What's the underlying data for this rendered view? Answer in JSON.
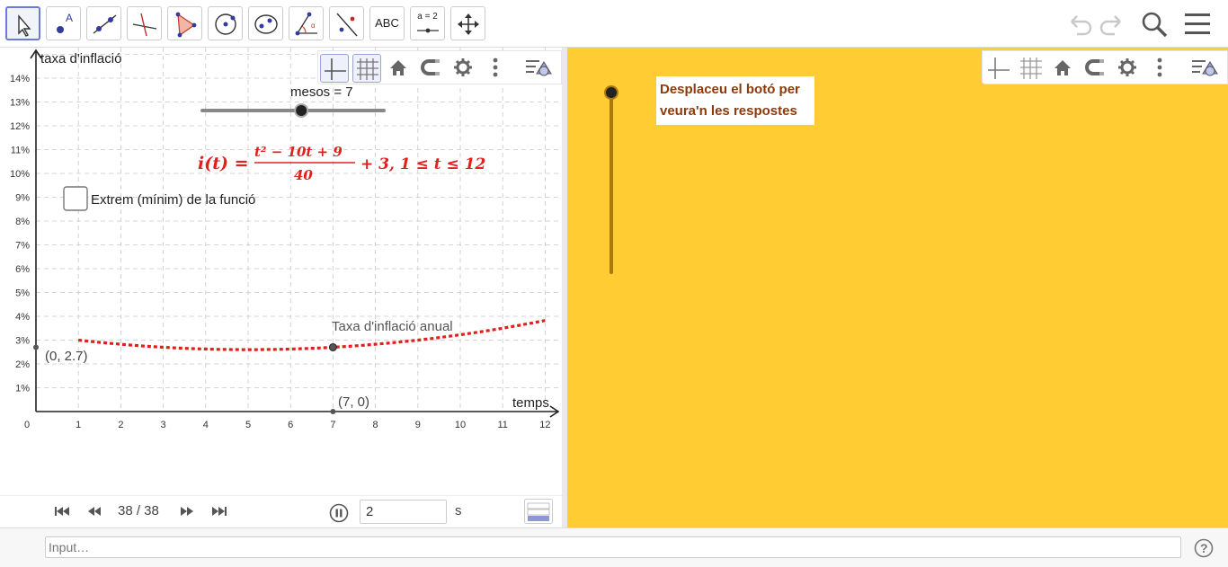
{
  "toolbar": {
    "tools": [
      {
        "name": "move-tool",
        "label": ""
      },
      {
        "name": "point-tool",
        "label": ""
      },
      {
        "name": "line-tool",
        "label": ""
      },
      {
        "name": "perpendicular-tool",
        "label": ""
      },
      {
        "name": "polygon-tool",
        "label": ""
      },
      {
        "name": "circle-tool",
        "label": ""
      },
      {
        "name": "ellipse-tool",
        "label": ""
      },
      {
        "name": "angle-tool",
        "label": ""
      },
      {
        "name": "reflect-tool",
        "label": ""
      },
      {
        "name": "text-tool",
        "label": "ABC"
      },
      {
        "name": "slider-tool",
        "label": "a = 2"
      },
      {
        "name": "move-graphics-tool",
        "label": ""
      }
    ],
    "undo_icon": "undo-icon",
    "redo_icon": "redo-icon",
    "search_icon": "search-icon",
    "menu_icon": "menu-icon"
  },
  "graphics": {
    "y_axis_label": "taxa d'inflació",
    "x_axis_label": "temps",
    "slider_label": "mesos = 7",
    "checkbox_label": "Extrem (mínim) de la funció",
    "curve_label": "Taxa d'inflació anual",
    "point_y_label": "(0, 2.7)",
    "point_x_label": "(7, 0)",
    "formula": {
      "lhs": "i(t) =",
      "numerator": "t² − 10t + 9",
      "denominator": "40",
      "rhs": "+ 3,  1 ≤ t ≤ 12"
    },
    "x_ticks": [
      "0",
      "1",
      "2",
      "3",
      "4",
      "5",
      "6",
      "7",
      "8",
      "9",
      "10",
      "11",
      "12"
    ],
    "y_ticks": [
      "1%",
      "2%",
      "3%",
      "4%",
      "5%",
      "6%",
      "7%",
      "8%",
      "9%",
      "10%",
      "11%",
      "12%",
      "13%",
      "14%"
    ],
    "curve_color": "#e0201b",
    "slider_value": 7,
    "slider_min": 1,
    "slider_max": 12
  },
  "graphics2": {
    "answer_text": "Desplaceu el botó per veura'n les respostes",
    "background_color": "#ffcc33",
    "slider_level": 0
  },
  "playbar": {
    "frame_count": "38 / 38",
    "speed_value": "2",
    "speed_unit": "s"
  },
  "inputbar": {
    "placeholder": "Input…",
    "help_icon": "help-icon"
  }
}
